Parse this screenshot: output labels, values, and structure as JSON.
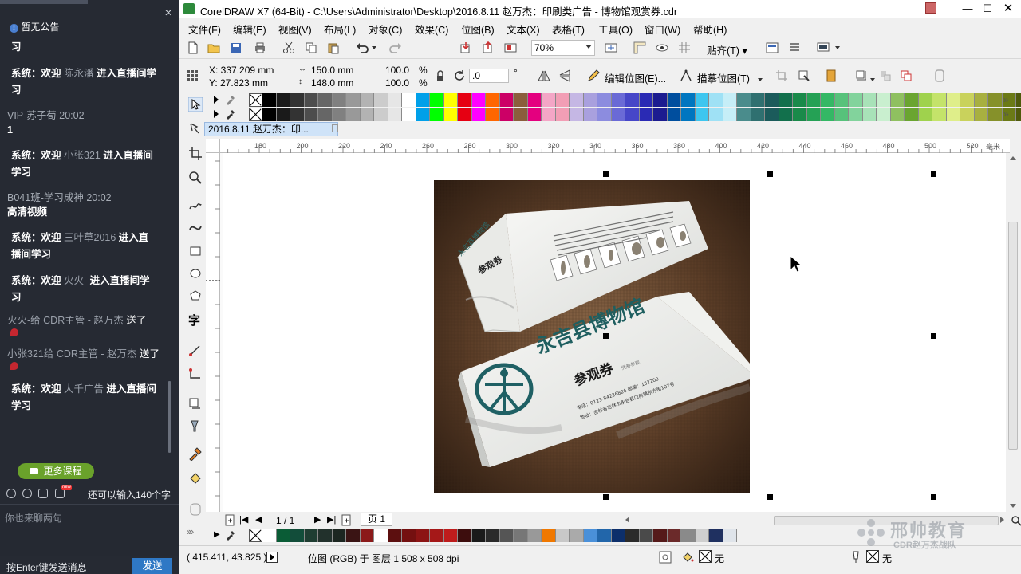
{
  "chat": {
    "announcement": "暂无公告",
    "messages": [
      {
        "prefix": "习",
        "type": "wrap"
      },
      {
        "type": "system",
        "label": "系统：欢迎",
        "user": "陈永潘",
        "action": "进入直播间学",
        "tail": "习"
      },
      {
        "type": "user",
        "head": "VIP-苏子荀 20:02",
        "body": "1"
      },
      {
        "type": "system",
        "label": "系统：欢迎",
        "user": "小张321",
        "action": "进入直播间",
        "tail": "学习"
      },
      {
        "type": "user",
        "head": "B041班-学习成神 20:02",
        "body": "高清视频"
      },
      {
        "type": "system",
        "label": "系统：欢迎",
        "user": "三叶草2016",
        "action": "进入直",
        "tail": "播间学习"
      },
      {
        "type": "system",
        "label": "系统：欢迎",
        "user": "火火-",
        "action": "进入直播间学",
        "tail": "习"
      },
      {
        "type": "gift",
        "from": "火火-给",
        "to": "CDR主管 - 赵万杰",
        "verb": "送了"
      },
      {
        "type": "gift",
        "from": "小张321给",
        "to": "CDR主管 - 赵万杰",
        "verb": "送了"
      },
      {
        "type": "system",
        "label": "系统：欢迎",
        "user": "大千广告",
        "action": "进入直播间",
        "tail": "学习"
      }
    ],
    "more_courses": "更多课程",
    "char_count": "还可以输入140个字",
    "new_badge": "new",
    "input_placeholder": "你也来聊两句",
    "enter_hint": "按Enter键发送消息",
    "send": "发送"
  },
  "app": {
    "title": "CorelDRAW X7 (64-Bit) - C:\\Users\\Administrator\\Desktop\\2016.8.11 赵万杰：印刷类广告 - 博物馆观赏券.cdr",
    "menu": [
      "文件(F)",
      "编辑(E)",
      "视图(V)",
      "布局(L)",
      "对象(C)",
      "效果(C)",
      "位图(B)",
      "文本(X)",
      "表格(T)",
      "工具(O)",
      "窗口(W)",
      "帮助(H)"
    ],
    "zoom": "70%",
    "snap": "贴齐(T)",
    "x": "X: 337.209 mm",
    "y": "Y: 27.823 mm",
    "w": "150.0 mm",
    "h": "148.0 mm",
    "sx": "100.0",
    "sy": "100.0",
    "pct": "%",
    "angle": ".0",
    "deg": "°",
    "edit_bitmap": "编辑位图(E)...",
    "trace_bitmap": "描摹位图(T)",
    "doc_tab": "2016.8.11 赵万杰：印...",
    "ruler_ticks": [
      "180",
      "200",
      "220",
      "240",
      "260",
      "280",
      "300",
      "320",
      "340",
      "360",
      "380",
      "400",
      "420",
      "440",
      "460",
      "480",
      "500",
      "520"
    ],
    "ruler_unit": "毫米",
    "page_counter": "1 / 1",
    "page_tab": "页 1",
    "cursor_pos": "( 415.411, 43.825 )",
    "selection_info": "位图 (RGB) 于 图层 1 508 x 508 dpi",
    "fill_none": "无",
    "outline_none": "无",
    "watermark_name": "邢帅教育",
    "watermark_sub": "CDR赵万杰战队",
    "ticket": {
      "museum": "永吉县博物馆",
      "pass": "参观券",
      "sub": "凭券参观",
      "tel": "电话：0123-84226826  邮编：132200",
      "addr": "地址：吉林省吉林市永吉县口前镇东方街107号",
      "pass_small": "参观券",
      "museum_small": "永吉县博物馆"
    }
  },
  "palette_top": [
    "#000000",
    "#1a1a1a",
    "#333333",
    "#4d4d4d",
    "#666666",
    "#808080",
    "#999999",
    "#b3b3b3",
    "#cccccc",
    "#e6e6e6",
    "#ffffff",
    "#00a0e9",
    "#00ff00",
    "#ffff00",
    "#e60012",
    "#ff00ff",
    "#ff6600",
    "#cc0066",
    "#8b5e3c",
    "#e4007f",
    "#f4a6c6",
    "#f29eb5",
    "#c5b7e4",
    "#a9a0de",
    "#8c8cdf",
    "#6a6ad6",
    "#4646c8",
    "#2a2ab4",
    "#1c1c90",
    "#004e9e",
    "#0076c0",
    "#3ec6ef",
    "#9fe1f5",
    "#c6eef7",
    "#4a8c8c",
    "#2f7070",
    "#1b5b5b",
    "#12704c",
    "#1a8a4a",
    "#25a155",
    "#34b865",
    "#57c27b",
    "#82d39c",
    "#a8e2b8",
    "#c9efcf",
    "#8fc060",
    "#6aa530",
    "#9fd24d",
    "#c4e36a",
    "#dfee8a",
    "#c9d25c",
    "#a8b040",
    "#86912a",
    "#6b7a16",
    "#4f5a0c"
  ],
  "palette_bottom": [
    "#ffffff",
    "#0a5c36",
    "#124d3a",
    "#1f3d32",
    "#22312c",
    "#1c2621",
    "#3a1414",
    "#8b1a1a",
    "#ffffff",
    "#5c0f0f",
    "#741010",
    "#8c1414",
    "#a51818",
    "#be1c1c",
    "#3d0d0d",
    "#1a1a1a",
    "#2a2a2a",
    "#555555",
    "#777777",
    "#999999",
    "#f07800",
    "#c8c8c8",
    "#aaaaaa",
    "#4a90d9",
    "#2266aa",
    "#0d2f6b",
    "#2b2b2b",
    "#4a4a4a",
    "#551a1a",
    "#6b2a2a",
    "#8a8a8a",
    "#cfcfcf",
    "#1f3060",
    "#dfe4ea"
  ]
}
